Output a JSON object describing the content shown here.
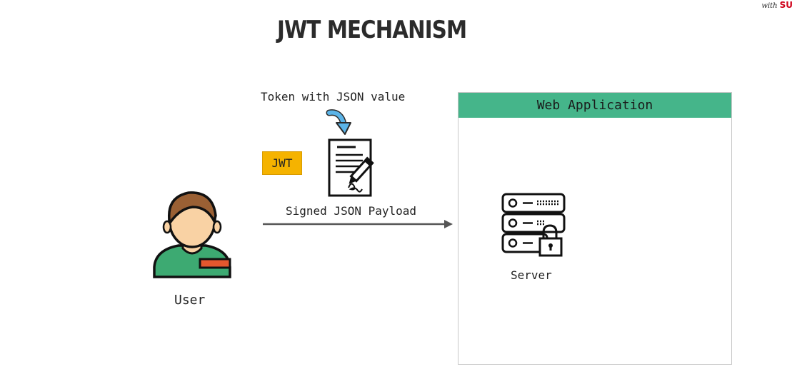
{
  "title": "JWT MECHANISM",
  "brand": {
    "script": "with",
    "mark": "SU"
  },
  "token_label": "Token with JSON value",
  "jwt_badge": "JWT",
  "payload_label": "Signed JSON Payload",
  "user_label": "User",
  "webapp": {
    "header": "Web Application",
    "server_label": "Server"
  },
  "colors": {
    "accent_green": "#45b58a",
    "badge_yellow": "#f5b300",
    "arrow_blue": "#5bb4e8",
    "id_orange": "#e4572e"
  },
  "icons": [
    "user-avatar-icon",
    "document-signature-icon",
    "curved-arrow-icon",
    "server-lock-icon"
  ]
}
